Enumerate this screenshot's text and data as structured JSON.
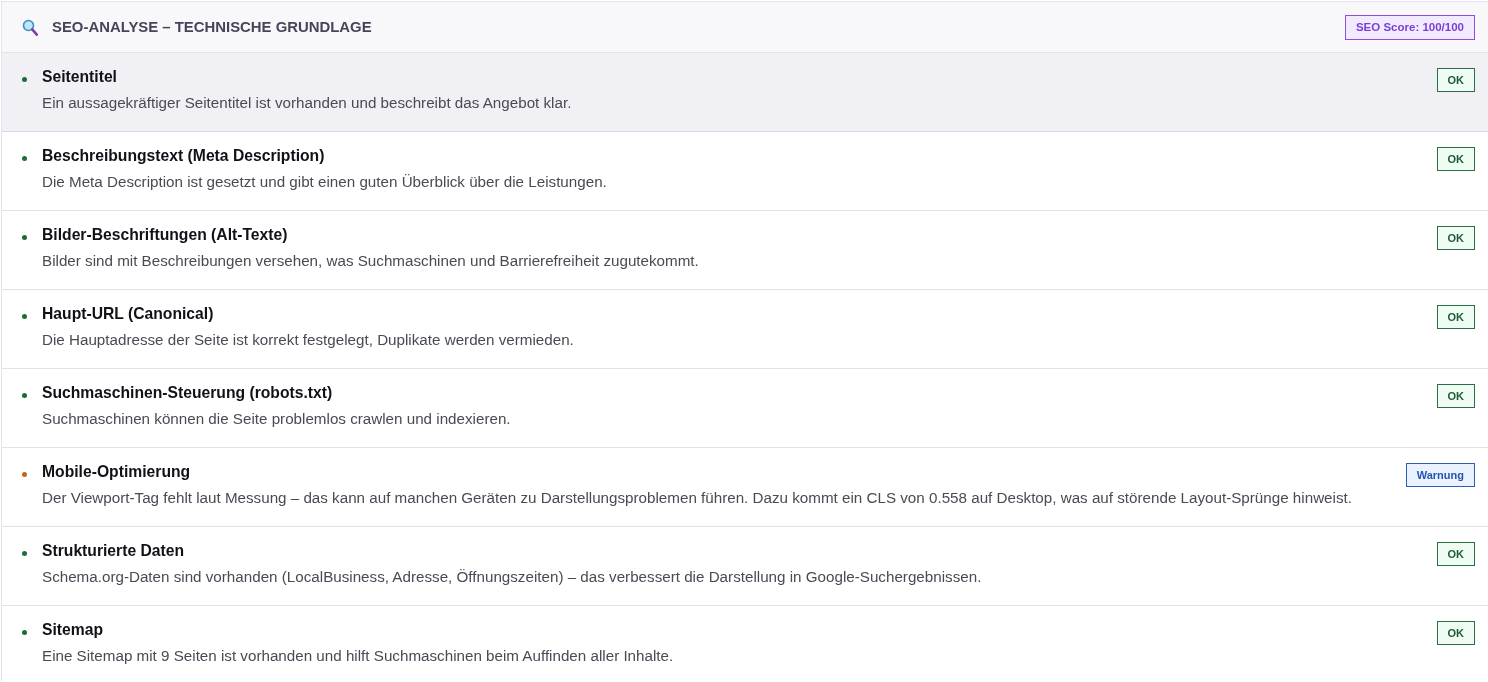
{
  "header": {
    "title": "SEO-ANALYSE – TECHNISCHE GRUNDLAGE",
    "score_badge": "SEO Score: 100/100"
  },
  "checks": [
    {
      "kind": "ok",
      "title": "Seitentitel",
      "description": "Ein aussagekräftiger Seitentitel ist vorhanden und beschreibt das Angebot klar.",
      "badge": "OK",
      "highlighted": true
    },
    {
      "kind": "ok",
      "title": "Beschreibungstext (Meta Description)",
      "description": "Die Meta Description ist gesetzt und gibt einen guten Überblick über die Leistungen.",
      "badge": "OK",
      "highlighted": false
    },
    {
      "kind": "ok",
      "title": "Bilder-Beschriftungen (Alt-Texte)",
      "description": "Bilder sind mit Beschreibungen versehen, was Suchmaschinen und Barrierefreiheit zugutekommt.",
      "badge": "OK",
      "highlighted": false
    },
    {
      "kind": "ok",
      "title": "Haupt-URL (Canonical)",
      "description": "Die Hauptadresse der Seite ist korrekt festgelegt, Duplikate werden vermieden.",
      "badge": "OK",
      "highlighted": false
    },
    {
      "kind": "ok",
      "title": "Suchmaschinen-Steuerung (robots.txt)",
      "description": "Suchmaschinen können die Seite problemlos crawlen und indexieren.",
      "badge": "OK",
      "highlighted": false
    },
    {
      "kind": "warning",
      "title": "Mobile-Optimierung",
      "description": "Der Viewport-Tag fehlt laut Messung – das kann auf manchen Geräten zu Darstellungsproblemen führen. Dazu kommt ein CLS von 0.558 auf Desktop, was auf störende Layout-Sprünge hinweist.",
      "badge": "Warnung",
      "highlighted": false
    },
    {
      "kind": "ok",
      "title": "Strukturierte Daten",
      "description": "Schema.org-Daten sind vorhanden (LocalBusiness, Adresse, Öffnungszeiten) – das verbessert die Darstellung in Google-Suchergebnissen.",
      "badge": "OK",
      "highlighted": false
    },
    {
      "kind": "ok",
      "title": "Sitemap",
      "description": "Eine Sitemap mit 9 Seiten ist vorhanden und hilft Suchmaschinen beim Auffinden aller Inhalte.",
      "badge": "OK",
      "highlighted": false
    }
  ]
}
